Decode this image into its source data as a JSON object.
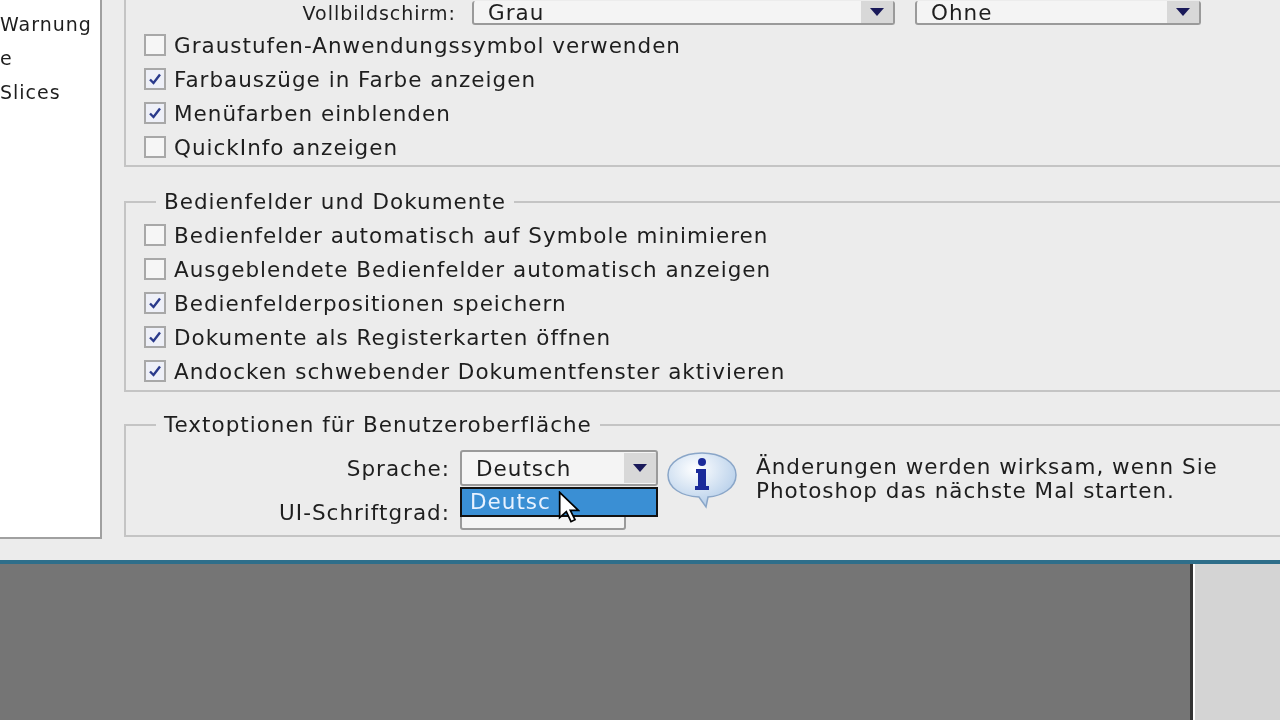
{
  "sidebar": {
    "items": [
      "Warnung",
      "e",
      "Slices"
    ]
  },
  "appearance": {
    "fullscreen_label": "Vollbildschirm:",
    "selects": [
      {
        "value": "Grau"
      },
      {
        "value": "Ohne"
      }
    ],
    "options": [
      {
        "label": "Graustufen-Anwendungssymbol verwenden",
        "checked": false
      },
      {
        "label": "Farbauszüge in Farbe anzeigen",
        "checked": true
      },
      {
        "label": "Menüfarben einblenden",
        "checked": true
      },
      {
        "label": "QuickInfo anzeigen",
        "checked": false
      }
    ]
  },
  "panels_group": {
    "title": "Bedienfelder und Dokumente",
    "options": [
      {
        "label": "Bedienfelder automatisch auf Symbole minimieren",
        "checked": false
      },
      {
        "label": "Ausgeblendete Bedienfelder automatisch anzeigen",
        "checked": false
      },
      {
        "label": "Bedienfelderpositionen speichern",
        "checked": true
      },
      {
        "label": "Dokumente als Registerkarten öffnen",
        "checked": true
      },
      {
        "label": "Andocken schwebender Dokumentfenster aktivieren",
        "checked": true
      }
    ]
  },
  "text_group": {
    "title": "Textoptionen für Benutzeroberfläche",
    "language": {
      "label": "Sprache:",
      "value": "Deutsch",
      "list": [
        {
          "label": "Deutsc",
          "selected": true
        }
      ]
    },
    "font_size": {
      "label": "UI-Schriftgrad:"
    },
    "notice": "Änderungen werden wirksam, wenn Sie Photoshop das nächste Mal starten."
  }
}
